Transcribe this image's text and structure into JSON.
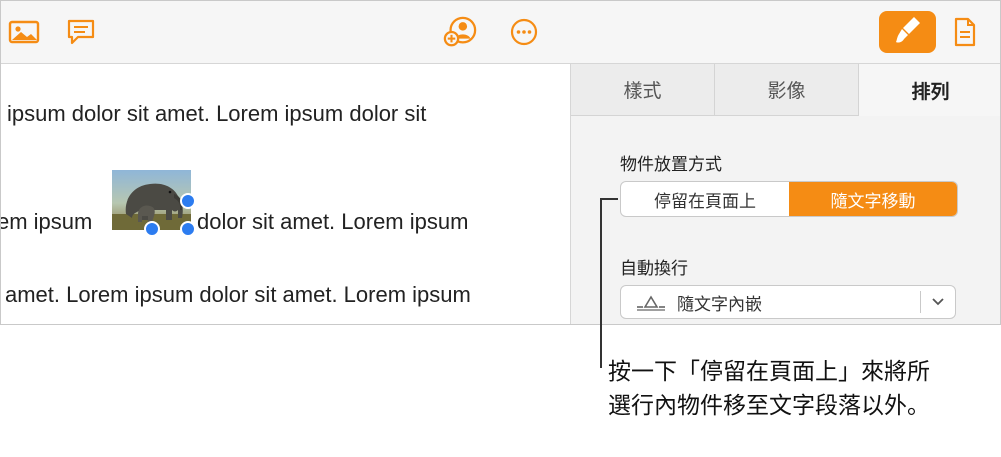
{
  "document": {
    "line1": "ipsum dolor sit amet.  Lorem ipsum dolor sit",
    "line2_before": "em ipsum",
    "line2_after": "dolor sit amet. Lorem ipsum",
    "line3": "amet. Lorem ipsum dolor sit amet. Lorem ipsum",
    "image_icon": "elephant-photo"
  },
  "toolbar": {
    "icons": [
      "media-icon",
      "comment-icon",
      "collaborate-icon",
      "more-icon",
      "format-brush-icon",
      "document-icon"
    ],
    "accent": "#f58c14"
  },
  "sidebar": {
    "tabs": [
      {
        "label": "樣式",
        "active": false
      },
      {
        "label": "影像",
        "active": false
      },
      {
        "label": "排列",
        "active": true
      }
    ],
    "placement_label": "物件放置方式",
    "placement_options": [
      {
        "label": "停留在頁面上",
        "selected": false
      },
      {
        "label": "隨文字移動",
        "selected": true
      }
    ],
    "wrap_label": "自動換行",
    "wrap_value": "隨文字內嵌"
  },
  "callout": {
    "text": "按一下「停留在頁面上」來將所選行內物件移至文字段落以外。"
  }
}
